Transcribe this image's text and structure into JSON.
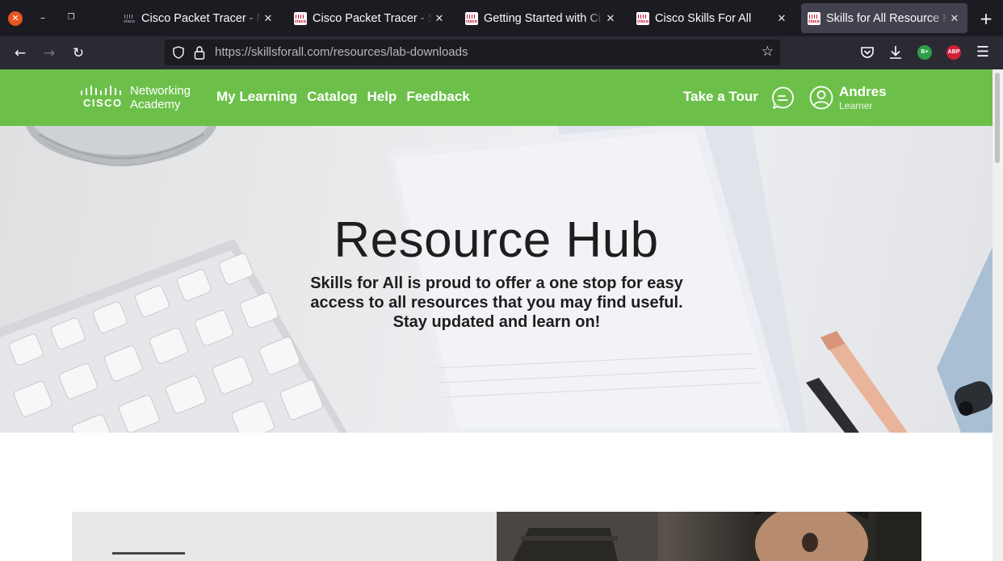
{
  "browser": {
    "tabs": [
      {
        "title": "Cisco Packet Tracer - Ne",
        "active": false
      },
      {
        "title": "Cisco Packet Tracer - Sk",
        "active": false
      },
      {
        "title": "Getting Started with Ci",
        "active": false
      },
      {
        "title": "Cisco Skills For All",
        "active": false
      },
      {
        "title": "Skills for All Resource H",
        "active": true
      }
    ],
    "url_host": "https://skillsforall.com",
    "url_path": "/resources/lab-downloads",
    "extensions": {
      "bplus": "B+",
      "abp": "ABP"
    }
  },
  "site": {
    "logo": {
      "brand": "CISCO",
      "line1": "Networking",
      "line2": "Academy"
    },
    "nav": [
      "My Learning",
      "Catalog",
      "Help",
      "Feedback"
    ],
    "tour": "Take a Tour",
    "user": {
      "name": "Andres",
      "role": "Learner"
    },
    "accent": "#6cc04a"
  },
  "hero": {
    "title": "Resource Hub",
    "subtitle_lines": [
      "Skills for All is proud to offer a one stop for easy",
      "access to all resources that you may find useful.",
      "Stay updated and learn on!"
    ]
  }
}
